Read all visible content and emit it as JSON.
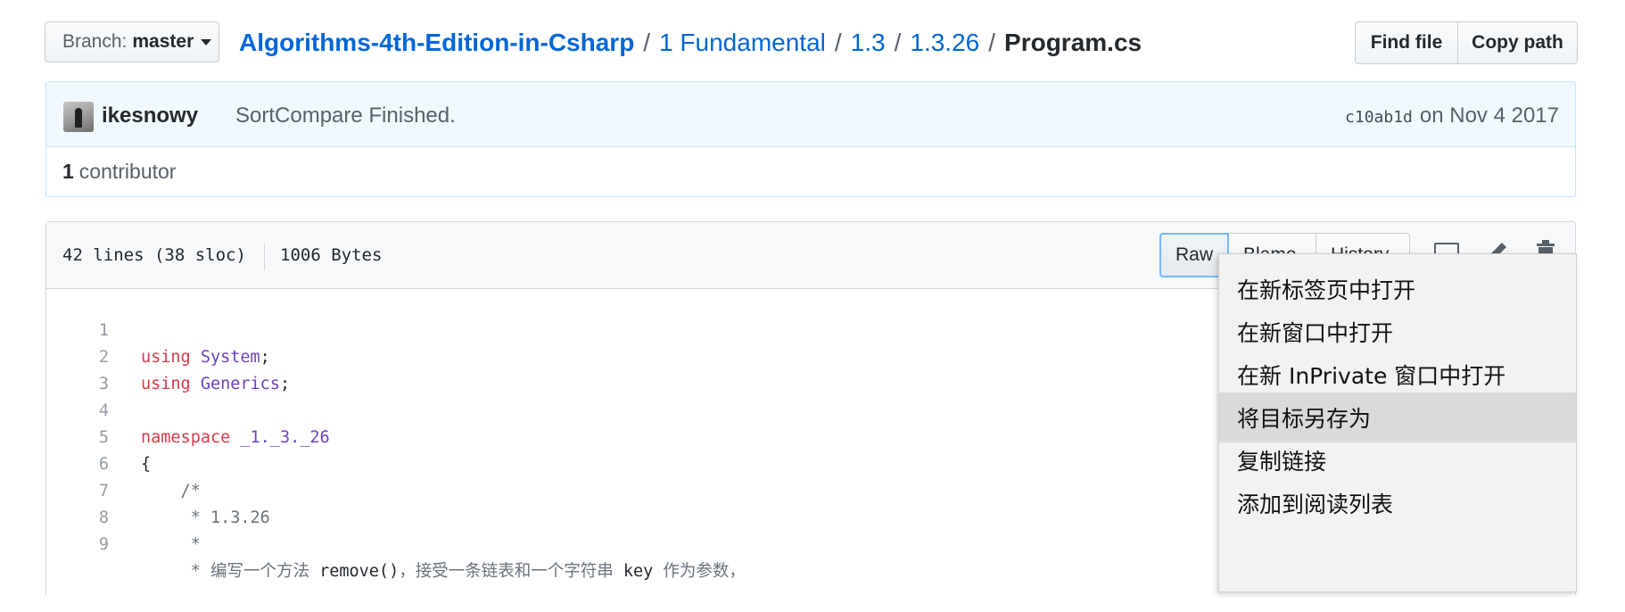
{
  "branch": {
    "prefix": "Branch:",
    "name": "master"
  },
  "breadcrumb": {
    "repo": "Algorithms-4th-Edition-in-Csharp",
    "path": [
      "1 Fundamental",
      "1.3",
      "1.3.26"
    ],
    "file": "Program.cs",
    "separator": "/"
  },
  "file_buttons": {
    "find_file": "Find file",
    "copy_path": "Copy path"
  },
  "commit": {
    "author": "ikesnowy",
    "message": "SortCompare Finished.",
    "sha": "c10ab1d",
    "date": "on Nov 4 2017"
  },
  "contributors": {
    "count": "1",
    "label": "contributor"
  },
  "file_info": {
    "lines": "42 lines (38 sloc)",
    "size": "1006 Bytes"
  },
  "file_actions": {
    "raw": "Raw",
    "blame": "Blame",
    "history": "History"
  },
  "icons": [
    "desktop-icon",
    "pencil-icon",
    "trash-icon"
  ],
  "code_lines": [
    {
      "n": "1",
      "parts": [
        [
          "kw",
          "using"
        ],
        [
          "",
          ""
        ],
        [
          "",
          ""
        ]
      ]
    },
    {
      "n": "2"
    },
    {
      "n": "3"
    },
    {
      "n": "4"
    },
    {
      "n": "5"
    },
    {
      "n": "6"
    },
    {
      "n": "7"
    },
    {
      "n": "8"
    },
    {
      "n": "9"
    }
  ],
  "code": {
    "l1": {
      "num": "1",
      "kw": "using",
      "ty": "System",
      "rest": ";"
    },
    "l2": {
      "num": "2",
      "kw": "using",
      "ty": "Generics",
      "rest": ";"
    },
    "l3": {
      "num": "3"
    },
    "l4": {
      "num": "4",
      "kw": "namespace",
      "ty": "_1._3._26"
    },
    "l5": {
      "num": "5",
      "text": "{"
    },
    "l6": {
      "num": "6",
      "text": "    /*"
    },
    "l7": {
      "num": "7",
      "text": "     * 1.3.26"
    },
    "l8": {
      "num": "8",
      "text": "     *"
    },
    "l9": {
      "num": "9",
      "pre": "     * 编写一个方法 ",
      "mid1": "remove()",
      "pre2": "，接受一条链表和一个字符串 ",
      "mid2": "key",
      "post": " 作为参数，"
    }
  },
  "context_menu": {
    "items": [
      "在新标签页中打开",
      "在新窗口中打开",
      "在新 InPrivate 窗口中打开",
      "将目标另存为",
      "复制链接",
      "添加到阅读列表"
    ],
    "highlighted_index": 3
  },
  "colors": {
    "link": "#0366d6",
    "keyword": "#d73a49",
    "type": "#6f42c1",
    "comment": "#6a737d",
    "commit_bg": "#f1f8ff",
    "menu_bg": "#f2f2f2",
    "menu_highlight": "#dadada"
  }
}
